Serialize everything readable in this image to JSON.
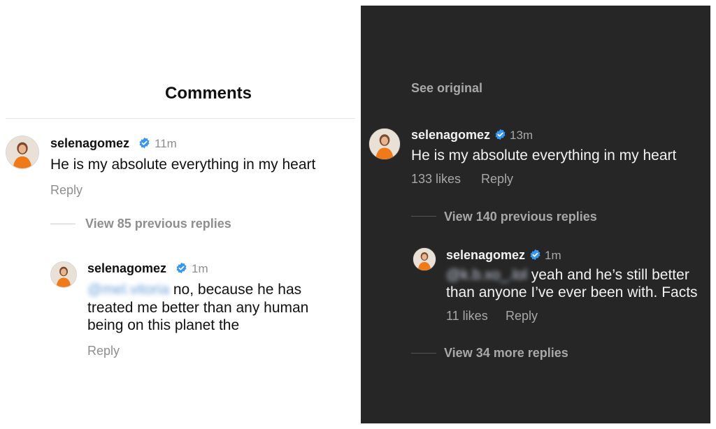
{
  "left_panel": {
    "header_title": "Comments",
    "comment": {
      "username": "selenagomez",
      "time": "11m",
      "text": "He is my absolute everything in my heart",
      "reply_label": "Reply"
    },
    "view_replies": "View 85 previous replies",
    "reply": {
      "username": "selenagomez",
      "time": "1m",
      "mention": "@mel.vitoria",
      "text_line1": "no, because he has",
      "text_line2": "treated me better than any human",
      "text_line3": "being on this planet the",
      "reply_label": "Reply"
    }
  },
  "right_panel": {
    "see_original": "See original",
    "comment": {
      "username": "selenagomez",
      "time": "13m",
      "text": "He is my absolute everything in my heart",
      "likes": "133 likes",
      "reply_label": "Reply"
    },
    "view_replies": "View 140 previous replies",
    "reply": {
      "username": "selenagomez",
      "time": "1m",
      "mention": "@k.b.xo_.lol",
      "text_line1": "yeah and he’s still better",
      "text_line2": "than anyone I’ve ever been with. Facts",
      "likes": "11 likes",
      "reply_label": "Reply"
    },
    "view_more": "View 34 more replies"
  },
  "colors": {
    "verified_badge": "#3797f0",
    "dark_background": "#262626",
    "avatar_dress": "#f07a1a"
  },
  "icons": [
    "verified-badge-icon",
    "avatar"
  ]
}
